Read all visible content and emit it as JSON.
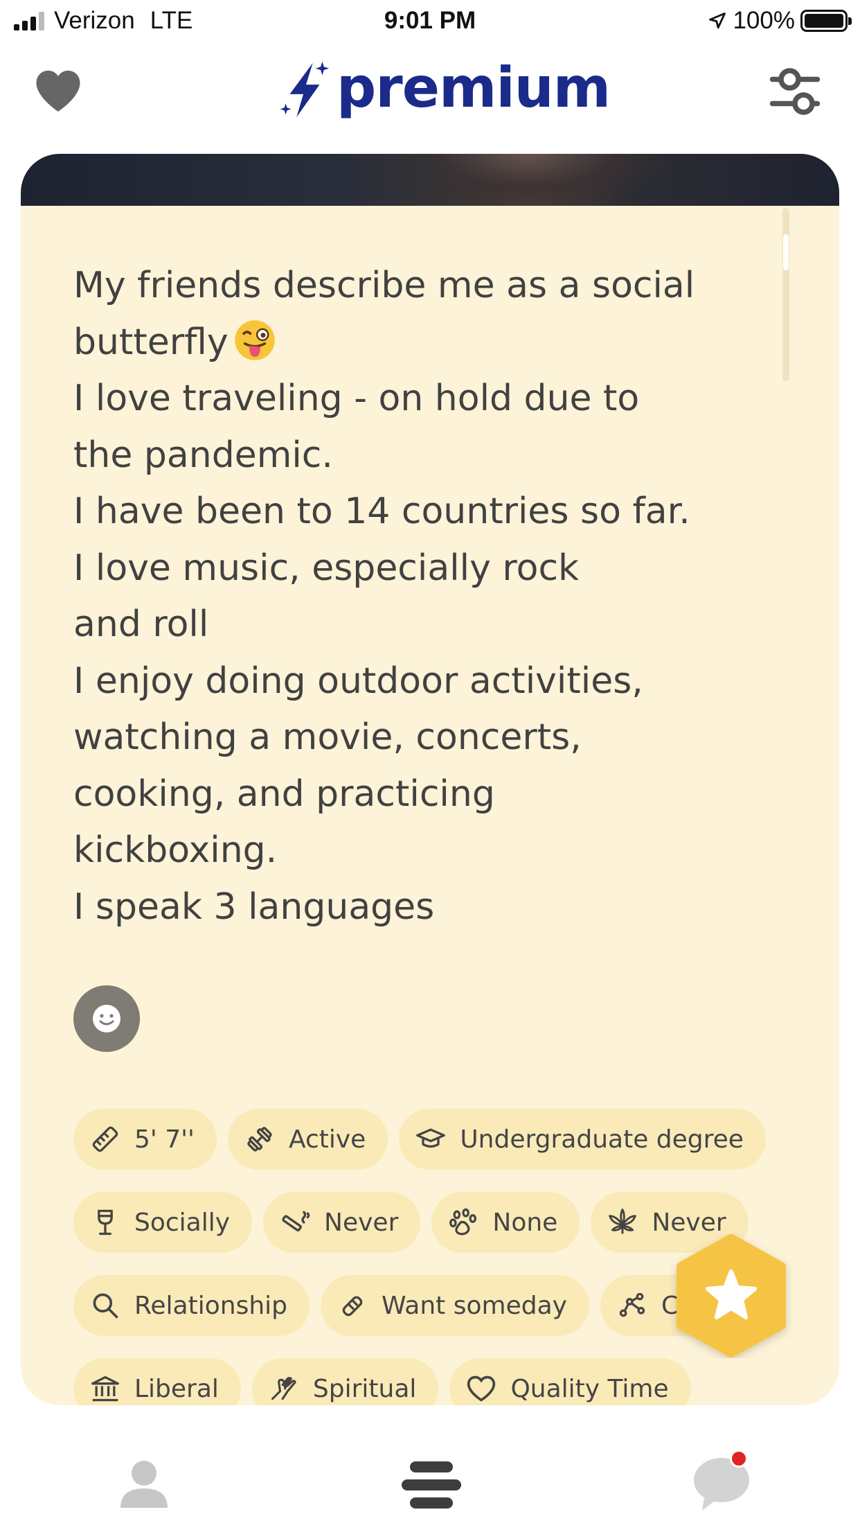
{
  "status_bar": {
    "carrier": "Verizon",
    "network": "LTE",
    "time": "9:01 PM",
    "battery": "100%"
  },
  "header": {
    "logo_text": "premium",
    "logo_color": "#1a2b8a",
    "left_icon": "heart-icon",
    "right_icon": "filter-sliders-icon"
  },
  "profile": {
    "bio_lines": [
      "My friends describe me as a social",
      "butterfly",
      "I love traveling - on hold due to",
      "the pandemic.",
      "I have been to 14 countries so far.",
      "I love music, especially rock",
      "and roll",
      "I enjoy doing outdoor activities,",
      "watching a movie, concerts,",
      "cooking, and practicing",
      "kickboxing.",
      "I speak 3 languages"
    ],
    "card_background": "#fdf3d8",
    "chip_background": "#faeab8",
    "chips": {
      "height": {
        "label": "5' 7''",
        "icon": "ruler-icon"
      },
      "exercise": {
        "label": "Active",
        "icon": "dumbbell-icon"
      },
      "education": {
        "label": "Undergraduate degree",
        "icon": "graduation-cap-icon"
      },
      "drinking": {
        "label": "Socially",
        "icon": "wine-glass-icon"
      },
      "smoking": {
        "label": "Never",
        "icon": "cigarette-icon"
      },
      "pets": {
        "label": "None",
        "icon": "paw-icon"
      },
      "cannabis": {
        "label": "Never",
        "icon": "cannabis-leaf-icon"
      },
      "looking_for": {
        "label": "Relationship",
        "icon": "magnifier-icon"
      },
      "kids": {
        "label": "Want someday",
        "icon": "pacifier-icon"
      },
      "star_sign": {
        "label": "Ca",
        "icon": "constellation-icon"
      },
      "politics": {
        "label": "Liberal",
        "icon": "institution-icon"
      },
      "religion": {
        "label": "Spiritual",
        "icon": "praying-hands-icon"
      },
      "love_language": {
        "label": "Quality Time",
        "icon": "heart-outline-icon"
      }
    }
  },
  "fab": {
    "icon": "star-icon",
    "color": "#f5c445"
  },
  "bottom_nav": {
    "items": [
      "profile-icon",
      "feed-icon",
      "chat-bubble-icon"
    ],
    "chat_has_notification": true,
    "notification_color": "#e02424"
  }
}
